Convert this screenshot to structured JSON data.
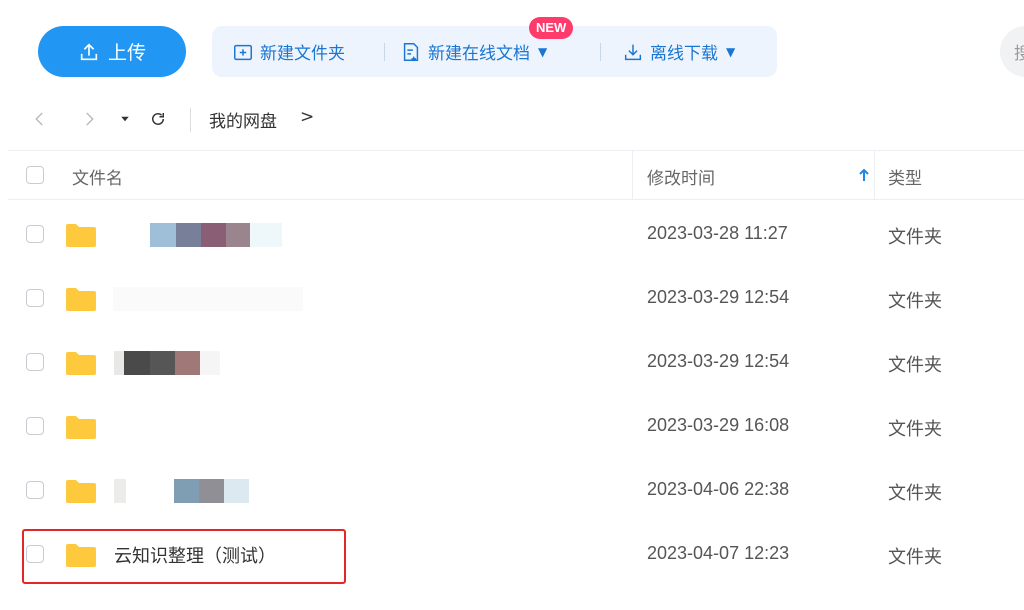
{
  "toolbar": {
    "upload_label": "上传",
    "new_folder_label": "新建文件夹",
    "new_online_doc_label": "新建在线文档",
    "new_badge": "NEW",
    "offline_download_label": "离线下载",
    "search_placeholder_partial": "搜"
  },
  "nav": {
    "breadcrumb_root": "我的网盘",
    "breadcrumb_sep": ">"
  },
  "table": {
    "columns": {
      "name": "文件名",
      "modified": "修改时间",
      "type": "类型"
    },
    "rows": [
      {
        "name": "",
        "modified": "2023-03-28 11:27",
        "type": "文件夹"
      },
      {
        "name": "",
        "modified": "2023-03-29 12:54",
        "type": "文件夹"
      },
      {
        "name": "",
        "modified": "2023-03-29 12:54",
        "type": "文件夹"
      },
      {
        "name": "",
        "modified": "2023-03-29 16:08",
        "type": "文件夹"
      },
      {
        "name": "",
        "modified": "2023-04-06 22:38",
        "type": "文件夹"
      },
      {
        "name": "云知识整理（测试）",
        "modified": "2023-04-07 12:23",
        "type": "文件夹"
      }
    ]
  },
  "colors": {
    "accent": "#2196f3",
    "tool_text": "#1976d2",
    "badge": "#ff3b6b",
    "folder": "#ffc93d",
    "highlight": "#e32626"
  }
}
